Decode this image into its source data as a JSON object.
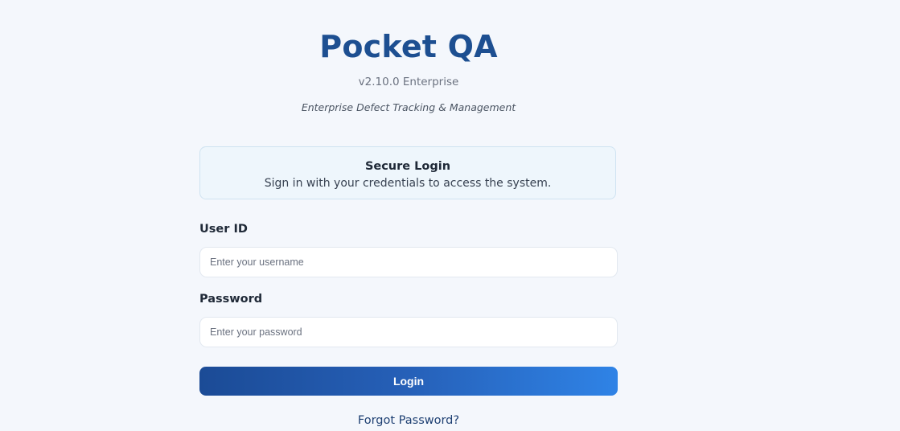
{
  "app": {
    "title": "Pocket QA",
    "version": "v2.10.0 Enterprise",
    "tagline": "Enterprise Defect Tracking & Management"
  },
  "info_box": {
    "title": "Secure Login",
    "subtitle": "Sign in with your credentials to access the system."
  },
  "form": {
    "user_label": "User ID",
    "user_placeholder": "Enter your username",
    "user_value": "",
    "password_label": "Password",
    "password_placeholder": "Enter your password",
    "password_value": "",
    "login_label": "Login",
    "forgot_label": "Forgot Password?"
  },
  "colors": {
    "brand": "#1d4f91",
    "button_gradient_start": "#1b4b96",
    "button_gradient_end": "#2f83e6",
    "background": "#f4f7fc",
    "info_box_bg": "#eef6fc"
  }
}
